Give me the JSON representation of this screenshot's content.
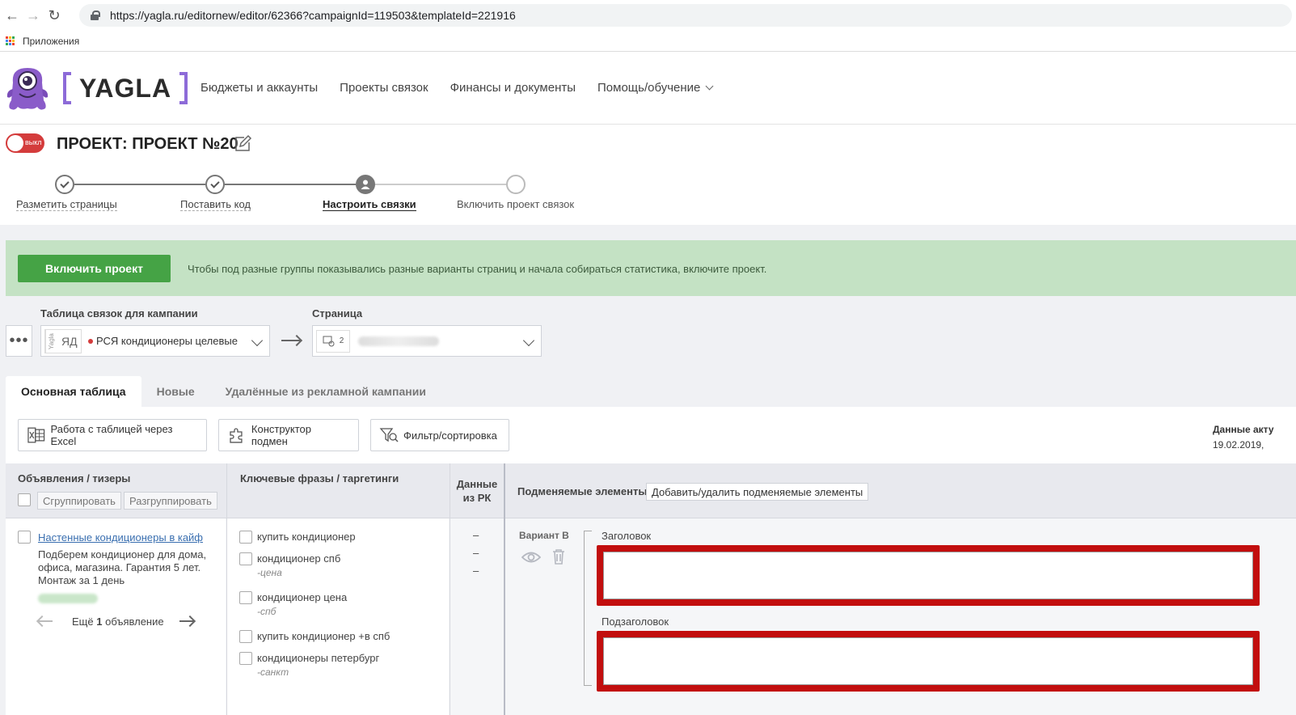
{
  "browser": {
    "url": "https://yagla.ru/editornew/editor/62366?campaignId=119503&templateId=221916",
    "bookmarks_label": "Приложения"
  },
  "header": {
    "logo_word": "YAGLA",
    "nav": [
      "Бюджеты и аккаунты",
      "Проекты связок",
      "Финансы и документы",
      "Помощь/обучение"
    ]
  },
  "project": {
    "toggle_label": "выкл",
    "title": "ПРОЕКТ: ПРОЕКТ №20"
  },
  "steps": [
    {
      "label": "Разметить страницы",
      "state": "done"
    },
    {
      "label": "Поставить код",
      "state": "done"
    },
    {
      "label": "Настроить связки",
      "state": "current"
    },
    {
      "label": "Включить проект связок",
      "state": "todo"
    }
  ],
  "banner": {
    "button": "Включить проект",
    "text": "Чтобы под разные группы показывались разные варианты страниц и начала собираться статистика, включите проект."
  },
  "selectors": {
    "campaign_label": "Таблица связок для кампании",
    "campaign_badge_vertical": "Yagla",
    "campaign_badge": "ЯД",
    "campaign_value": "РСЯ кондиционеры целевые",
    "page_label": "Страница",
    "page_badge_count": "2"
  },
  "tabs": [
    "Основная таблица",
    "Новые",
    "Удалённые из рекламной кампании"
  ],
  "toolbar": {
    "excel": "Работа с таблицей через Excel",
    "constructor": "Конструктор подмен",
    "filter": "Фильтр/сортировка",
    "data_actual_label": "Данные акту",
    "data_actual_date": "19.02.2019,"
  },
  "table": {
    "col_ads": "Объявления / тизеры",
    "col_keywords": "Ключевые фразы / таргетинги",
    "col_data": "Данные из РК",
    "col_elements": "Подменяемые элементы",
    "btn_group": "Сгруппировать",
    "btn_ungroup": "Разгруппировать",
    "btn_add_elements": "Добавить/удалить подменяемые элементы",
    "ad": {
      "title": "Настенные кондиционеры в кайф",
      "text": "Подберем кондиционер для дома, офиса, магазина. Гарантия 5 лет. Монтаж за 1 день",
      "more_prefix": "Ещё",
      "more_count": "1",
      "more_suffix": "объявление"
    },
    "keywords": [
      {
        "phrase": "купить кондиционер",
        "minus": ""
      },
      {
        "phrase": "кондиционер спб",
        "minus": "-цена"
      },
      {
        "phrase": "кондиционер цена",
        "minus": "-спб"
      },
      {
        "phrase": "купить кондиционер +в спб",
        "minus": ""
      },
      {
        "phrase": "кондиционеры петербург",
        "minus": "-санкт"
      }
    ],
    "data_dashes": [
      "–",
      "–",
      "–"
    ],
    "variant_label": "Вариант B",
    "field_title_label": "Заголовок",
    "field_subtitle_label": "Подзаголовок"
  }
}
